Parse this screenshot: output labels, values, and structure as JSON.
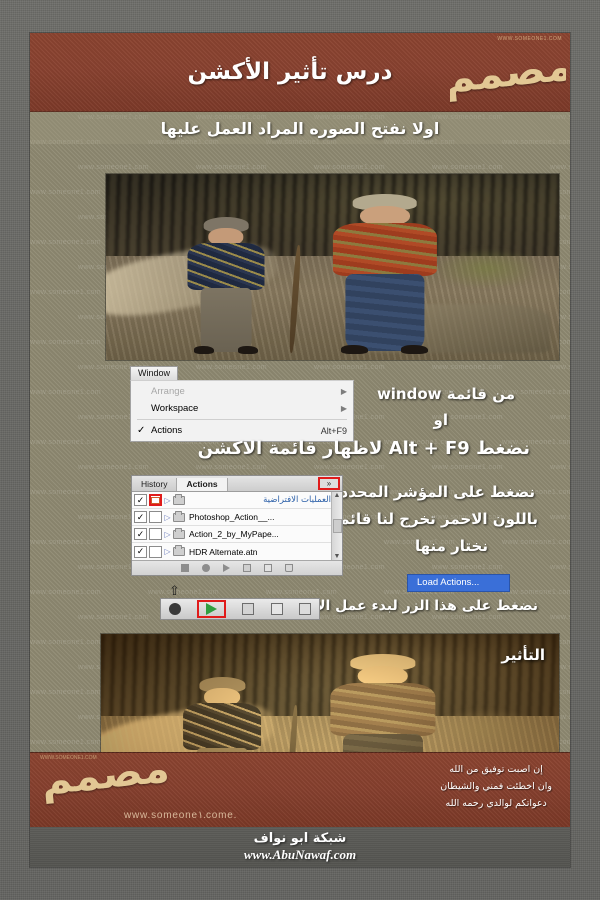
{
  "header": {
    "title": "درس تأثير الأكشن",
    "logo_calligraphy": "مصمم",
    "logo_url": "WWW.SOMEONE1.COM"
  },
  "subtitle": {
    "text": "اولا نفتح الصوره المراد العمل عليها"
  },
  "photos": {
    "original_alt": "two boys standing on dirt path",
    "effect_alt": "two boys standing on dirt path with sepia action effect",
    "effect_label": "التأثير"
  },
  "window_menu": {
    "tab_label": "Window",
    "items": [
      {
        "label": "Arrange",
        "shortcut": "",
        "arrow": "▶",
        "checked": false,
        "disabled": true
      },
      {
        "label": "Workspace",
        "shortcut": "",
        "arrow": "▶",
        "checked": false,
        "disabled": false
      },
      {
        "label": "Actions",
        "shortcut": "Alt+F9",
        "arrow": "",
        "checked": true,
        "disabled": false
      }
    ],
    "check_glyph": "✓"
  },
  "actions_panel": {
    "tabs": [
      {
        "label": "History",
        "active": false
      },
      {
        "label": "Actions",
        "active": true
      }
    ],
    "expand_glyph": "»",
    "rows": [
      {
        "name": "العمليات الافتراضية",
        "rtl": true,
        "checked": true,
        "red_box": true,
        "triangle": "▷"
      },
      {
        "name": "Photoshop_Action__...",
        "rtl": false,
        "checked": true,
        "red_box": false,
        "triangle": "▷"
      },
      {
        "name": "Action_2_by_MyPape...",
        "rtl": false,
        "checked": true,
        "red_box": false,
        "triangle": "▷"
      },
      {
        "name": "HDR Alternate.atn",
        "rtl": false,
        "checked": true,
        "red_box": false,
        "triangle": "▷"
      }
    ],
    "check_glyph": "✓",
    "scroll_up": "▲",
    "scroll_down": "▼",
    "footer_icons": [
      "stop-icon",
      "record-icon",
      "play-icon",
      "new-set-icon",
      "new-action-icon",
      "delete-icon"
    ],
    "cursor_glyph": "⇧"
  },
  "load_actions": {
    "label": "Load Actions..."
  },
  "zoom_toolbar": {
    "icons": [
      "record-icon",
      "play-icon",
      "new-set-icon",
      "new-action-icon",
      "delete-icon"
    ],
    "highlight_color": "#e01b1b",
    "play_color": "#2f9e3f"
  },
  "instructions": {
    "from_window_menu": "من قائمة window",
    "or": "او",
    "press_alt_f9": "نضغط Alt + F9 لاظهار قائمة الاكشن",
    "click_indicator": "نضغط على المؤشر المحدد",
    "red_color_menu": "باللون الاحمر تخرج لنا قائمه",
    "choose_from_it": "نختار منها",
    "press_button": "نضغط على هذا الزر لبدء عمل الاكشن"
  },
  "footer": {
    "calligraphy": "مصمم",
    "url": "www.someone١.come.",
    "watermark": "WWW.SOMEONE1.COM",
    "dua_lines": [
      "إن اصبت توفيق من الله",
      "وان اخطئت فمني والشيطان",
      "دعواتكم لوالدي رحمه الله"
    ]
  },
  "credit": {
    "site_name_ar": "شبكة ابو نواف",
    "site_url": "www.AbuNawaf.com"
  },
  "watermark": {
    "text": "WWW.SOMEONE1.COM"
  },
  "colors": {
    "banner_brown": "#8c4430",
    "sheet_tan": "#8f8a72",
    "outer_gray": "#6a6a66",
    "accent_red": "#e01b1b",
    "accent_blue": "#3a6fd8",
    "calligraphy_gold": "#e8cf9a"
  }
}
